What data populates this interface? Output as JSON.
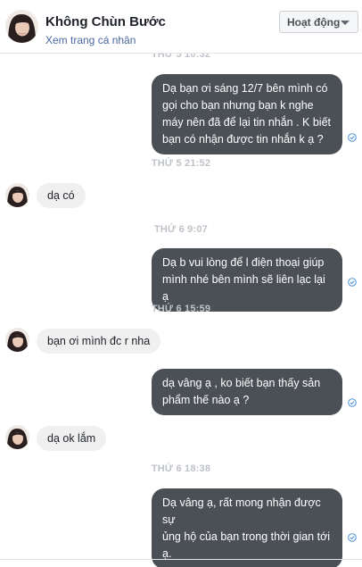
{
  "header": {
    "name": "Không Chùn Bước",
    "profile_link": "Xem trang cá nhân",
    "status_button": "Hoạt động"
  },
  "timestamps": [
    "THỨ 5 10:32",
    "THỨ 5 21:52",
    "THỨ 6 9:07",
    "THỨ 6 15:59",
    "THỨ 6 18:38"
  ],
  "messages": [
    {
      "from": "me",
      "text": "Dạ bạn ơi sáng 12/7 bên mình có\ngọi cho bạn nhưng bạn k nghe\nmáy nên đã để lại tin nhắn . K biết\nbạn có nhận được tin nhắn k ạ ?"
    },
    {
      "from": "them",
      "text": "dạ có"
    },
    {
      "from": "me",
      "text": "Dạ b vui lòng để l điện thoại giúp\nmình nhé bên mình sẽ liên lạc lại ạ"
    },
    {
      "from": "them",
      "text": "bạn ơi mình đc r nha"
    },
    {
      "from": "me",
      "text": "dạ vâng ạ ,  ko biết bạn thấy sản\nphẩm thế nào ạ ?"
    },
    {
      "from": "them",
      "text": "dạ ok lắm"
    },
    {
      "from": "me",
      "text": "Dạ vâng ạ, rất mong nhận được sự\nủng hộ của bạn trong thời gian tới\nạ."
    }
  ],
  "icons": {
    "seen": "check-circle-icon",
    "caret": "chevron-down-icon"
  },
  "colors": {
    "outgoing_bubble": "#4b4f56",
    "incoming_bubble": "#f1f0f0",
    "seen_check": "#4a90d9"
  }
}
